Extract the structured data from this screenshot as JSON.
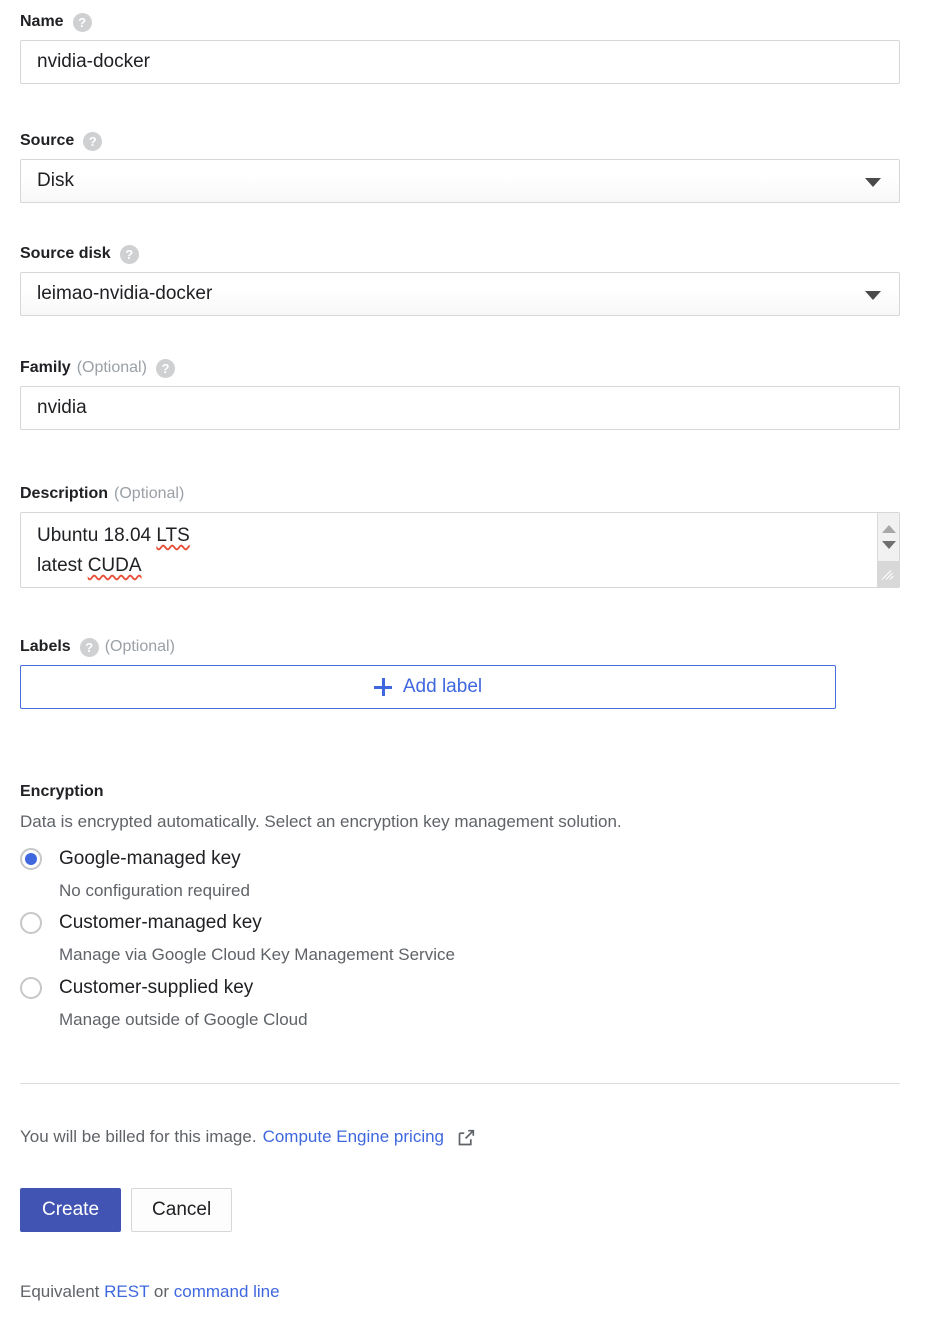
{
  "form": {
    "name": {
      "label": "Name",
      "help_icon": "help-circle-icon",
      "value": "nvidia-docker"
    },
    "source": {
      "label": "Source",
      "help_icon": "help-circle-icon",
      "value": "Disk",
      "dropdown_icon": "chevron-down-icon"
    },
    "source_disk": {
      "label": "Source disk",
      "help_icon": "help-circle-icon",
      "value": "leimao-nvidia-docker",
      "dropdown_icon": "chevron-down-icon"
    },
    "family": {
      "label": "Family",
      "optional": "(Optional)",
      "help_icon": "help-circle-icon",
      "value": "nvidia"
    },
    "description": {
      "label": "Description",
      "optional": "(Optional)",
      "line1_plain": "Ubuntu 18.04 ",
      "line1_misspelled": "LTS",
      "line2_plain": "latest ",
      "line2_misspelled": "CUDA",
      "scroll_up_icon": "scroll-up-arrow-icon",
      "scroll_down_icon": "scroll-down-arrow-icon",
      "resize_grip_icon": "resize-grip-icon"
    },
    "labels": {
      "label": "Labels",
      "help_icon": "help-circle-icon",
      "optional": "(Optional)",
      "add_button": "Add label",
      "add_icon": "plus-icon"
    }
  },
  "encryption": {
    "title": "Encryption",
    "description": "Data is encrypted automatically. Select an encryption key management solution.",
    "options": [
      {
        "label": "Google-managed key",
        "sub": "No configuration required",
        "selected": true
      },
      {
        "label": "Customer-managed key",
        "sub": "Manage via Google Cloud Key Management Service",
        "selected": false
      },
      {
        "label": "Customer-supplied key",
        "sub": "Manage outside of Google Cloud",
        "selected": false
      }
    ]
  },
  "footer": {
    "billing_text": "You will be billed for this image.",
    "billing_link": "Compute Engine pricing",
    "external_link_icon": "external-link-icon",
    "create_label": "Create",
    "cancel_label": "Cancel",
    "equivalent_prefix": "Equivalent",
    "equivalent_rest": "REST",
    "equivalent_or": "or",
    "equivalent_cli": "command line"
  },
  "colors": {
    "accent_blue": "#3f68df",
    "create_button_blue": "#4154b3",
    "label_gray": "#5f6368",
    "border_gray": "#d5d7da",
    "spellcheck_red": "#e8503a"
  }
}
